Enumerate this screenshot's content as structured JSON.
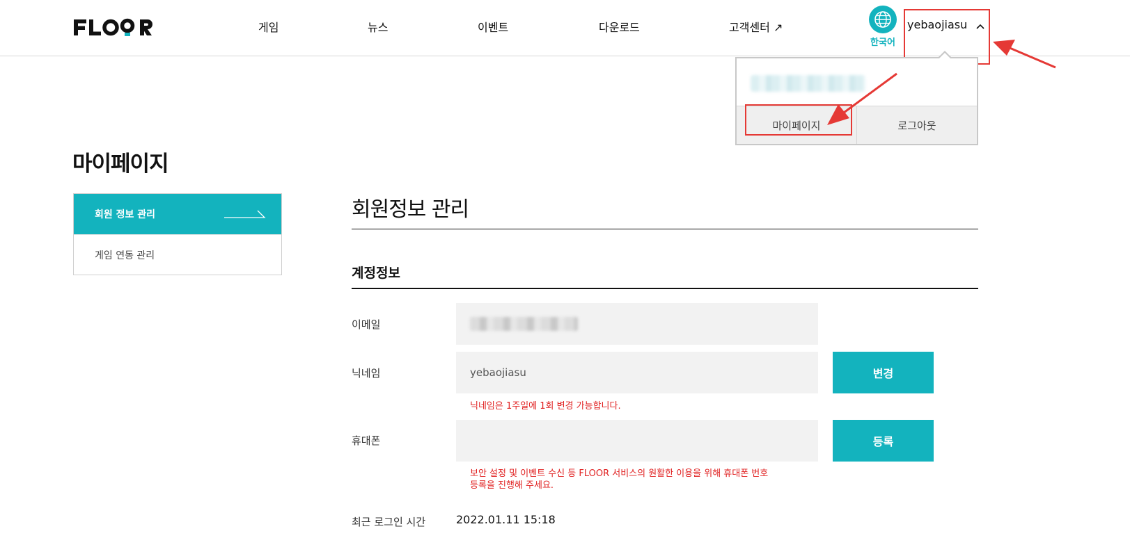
{
  "header": {
    "logo": "FLOOR",
    "nav": [
      {
        "label": "게임"
      },
      {
        "label": "뉴스"
      },
      {
        "label": "이벤트"
      },
      {
        "label": "다운로드"
      },
      {
        "label": "고객센터 ↗"
      }
    ],
    "language": {
      "label": "한국어",
      "icon": "globe-icon"
    },
    "user": {
      "name": "yebaojiasu",
      "icon": "chevron-up-icon"
    }
  },
  "dropdown": {
    "mypage_label": "마이페이지",
    "logout_label": "로그아웃"
  },
  "page": {
    "title": "마이페이지"
  },
  "sidebar": {
    "items": [
      {
        "label": "회원 정보 관리",
        "active": true
      },
      {
        "label": "게임 연동 관리",
        "active": false
      }
    ]
  },
  "content": {
    "section_title": "회원정보 관리",
    "account_title": "계정정보",
    "email": {
      "label": "이메일"
    },
    "nickname": {
      "label": "닉네임",
      "value": "yebaojiasu",
      "button": "변경",
      "note": "닉네임은 1주일에 1회 변경 가능합니다."
    },
    "phone": {
      "label": "휴대폰",
      "value": "",
      "button": "등록",
      "note_line1": "보안 설정 및 이벤트 수신 등 FLOOR 서비스의 원활한 이용을 위해 휴대폰 번호",
      "note_line2": "등록을 진행해 주세요."
    },
    "last_login": {
      "label": "최근 로그인 시간",
      "value": "2022.01.11 15:18"
    }
  },
  "colors": {
    "accent": "#13b3be",
    "annotation": "#e53935",
    "warning_text": "#e02020"
  }
}
